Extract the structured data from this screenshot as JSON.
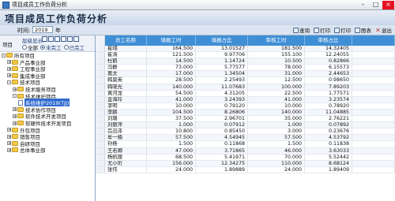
{
  "window": {
    "title": "项目成员工作负荷分析"
  },
  "header": {
    "title": "项目成员工作负荷分析"
  },
  "time": {
    "label": "时间:",
    "year": "2019",
    "unit": "年"
  },
  "toolbar": [
    {
      "name": "query",
      "label": "查询"
    },
    {
      "name": "print",
      "label": "打印"
    },
    {
      "name": "print-preview",
      "label": "打印"
    },
    {
      "name": "chart",
      "label": "图表"
    },
    {
      "name": "exit",
      "label": "退出"
    }
  ],
  "left": {
    "project_label": "项目",
    "display_label": "层级显示:",
    "radios": [
      {
        "label": "全部",
        "selected": false
      },
      {
        "label": "未完工",
        "selected": true
      },
      {
        "label": "已完工",
        "selected": false
      }
    ]
  },
  "tree": [
    {
      "label": "所有项目",
      "level": 0,
      "expander": "-"
    },
    {
      "label": "产品事业部",
      "level": 1,
      "expander": "+"
    },
    {
      "label": "工程事业部",
      "level": 1,
      "expander": "+"
    },
    {
      "label": "集成事业部",
      "level": 1,
      "expander": "+"
    },
    {
      "label": "技术项目",
      "level": 1,
      "expander": "-"
    },
    {
      "label": "技术服务项目",
      "level": 2,
      "expander": "+"
    },
    {
      "label": "技术维护项目",
      "level": 2,
      "expander": "-"
    },
    {
      "label": "系统维护2019(TJJ)",
      "level": 3,
      "expander": "",
      "selected": true
    },
    {
      "label": "技术协作项目",
      "level": 2,
      "expander": "+"
    },
    {
      "label": "软件技术开发项目",
      "level": 2,
      "expander": "+"
    },
    {
      "label": "软硬件技术开发项目",
      "level": 2,
      "expander": "+"
    },
    {
      "label": "外包项目",
      "level": 1,
      "expander": "+"
    },
    {
      "label": "销售项目",
      "level": 1,
      "expander": "+"
    },
    {
      "label": "自研项目",
      "level": 1,
      "expander": "+"
    },
    {
      "label": "总体事业部",
      "level": 1,
      "expander": "+"
    }
  ],
  "table": {
    "headers": [
      "员工名称",
      "填报工时",
      "填报占比",
      "审核工时",
      "审核占比"
    ],
    "rows": [
      [
        "崔翊",
        "164.500",
        "13.01527",
        "181.500",
        "14.32405"
      ],
      [
        "崔涛",
        "121.500",
        "9.97706",
        "155.100",
        "12.24055"
      ],
      [
        "杜鹤",
        "14.500",
        "1.14724",
        "10.500",
        "0.82866"
      ],
      [
        "冯静",
        "73.000",
        "5.77577",
        "78.000",
        "6.15573"
      ],
      [
        "葛文",
        "17.000",
        "1.34504",
        "31.000",
        "2.44653"
      ],
      [
        "韩莫英",
        "28.500",
        "2.25493",
        "12.500",
        "0.98650"
      ],
      [
        "韩晓光",
        "140.000",
        "11.07683",
        "100.000",
        "7.89203"
      ],
      [
        "黄河龙",
        "54.500",
        "4.31205",
        "22.500",
        "1.77571"
      ],
      [
        "金海玲",
        "41.000",
        "3.24393",
        "41.000",
        "3.23574"
      ],
      [
        "李明",
        "10.000",
        "0.79120",
        "10.000",
        "0.78920"
      ],
      [
        "李鹏",
        "104.500",
        "8.26806",
        "140.000",
        "11.04885"
      ],
      [
        "刘璐",
        "37.500",
        "2.96701",
        "35.000",
        "2.76221"
      ],
      [
        "刘丽萍",
        "1.000",
        "0.07912",
        "1.000",
        "0.07892"
      ],
      [
        "吕迅泽",
        "10.800",
        "0.85450",
        "3.000",
        "0.23676"
      ],
      [
        "牟一楠",
        "57.500",
        "4.54945",
        "57.500",
        "4.53792"
      ],
      [
        "孙杨",
        "1.500",
        "0.11868",
        "1.500",
        "0.11838"
      ],
      [
        "王若卿",
        "47.000",
        "3.71865",
        "46.000",
        "3.63033"
      ],
      [
        "杨帆丽",
        "68.500",
        "5.41971",
        "70.000",
        "5.52442"
      ],
      [
        "尤小珩",
        "156.000",
        "12.34275",
        "110.000",
        "8.68124"
      ],
      [
        "张伟",
        "24.000",
        "1.89889",
        "24.000",
        "1.89409"
      ]
    ]
  }
}
